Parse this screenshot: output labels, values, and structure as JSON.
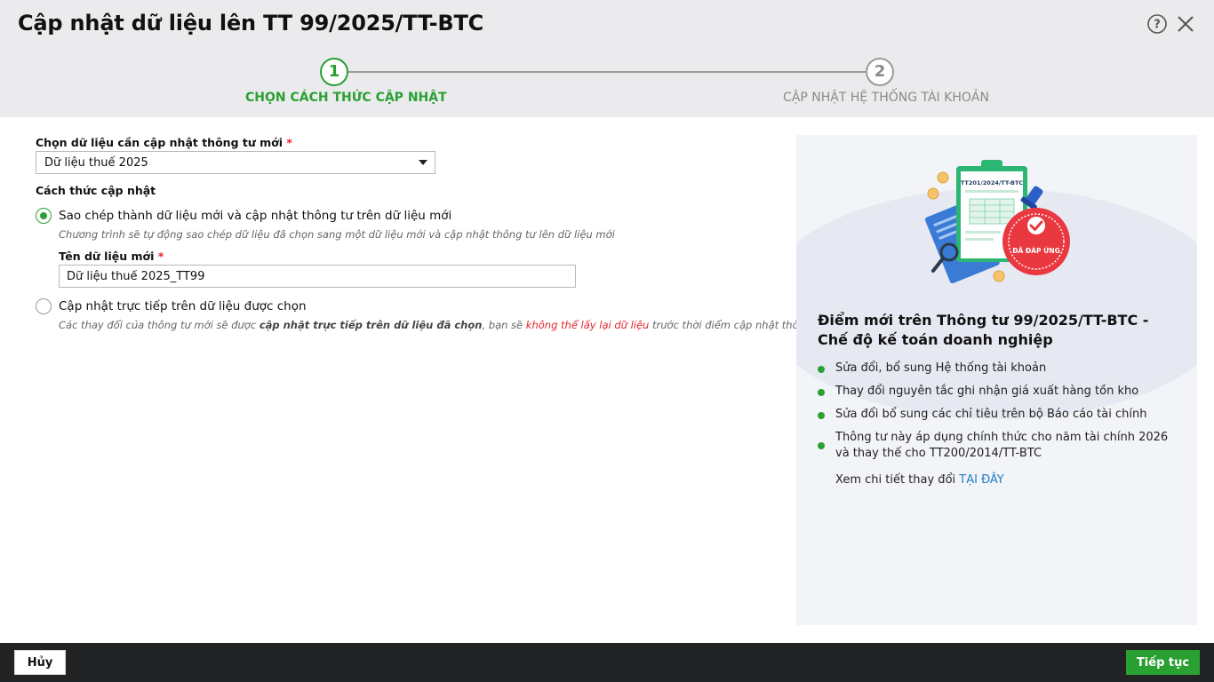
{
  "dialog": {
    "title": "Cập nhật dữ liệu lên TT 99/2025/TT-BTC"
  },
  "steps": [
    {
      "number": "1",
      "label": "CHỌN CÁCH THỨC CẬP NHẬT",
      "state": "active"
    },
    {
      "number": "2",
      "label": "CẬP NHẬT HỆ THỐNG TÀI KHOẢN",
      "state": "inactive"
    }
  ],
  "form": {
    "select_label": "Chọn dữ liệu cần cập nhật thông tư mới",
    "required_mark": "*",
    "select_value": "Dữ liệu thuế 2025",
    "method_label": "Cách thức cập nhật",
    "option_copy": {
      "label": "Sao chép thành dữ liệu mới và cập nhật thông tư trên dữ liệu mới",
      "description": "Chương trình sẽ tự động sao chép dữ liệu đã chọn sang một dữ liệu mới và cập nhật thông tư lên dữ liệu mới",
      "checked": true
    },
    "new_name_label": "Tên dữ liệu mới",
    "new_name_value": "Dữ liệu thuế 2025_TT99",
    "option_direct": {
      "label": "Cập nhật trực tiếp trên dữ liệu được chọn",
      "desc_part1": "Các thay đổi của thông tư mới sẽ được ",
      "desc_bold": "cập nhật trực tiếp trên dữ liệu đã chọn",
      "desc_part2": ", bạn sẽ ",
      "desc_red": "không thể lấy lại dữ liệu",
      "desc_part3": " trước thời điểm cập nhật thông tư",
      "checked": false
    }
  },
  "info_panel": {
    "illustration_doc_text": "TT201/2024/TT-BTC",
    "illustration_badge_text": "ĐÃ ĐÁP ỨNG",
    "title": "Điểm mới trên Thông tư 99/2025/TT-BTC - Chế độ kế toán doanh nghiệp",
    "bullets": [
      "Sửa đổi, bổ sung Hệ thống tài khoản",
      "Thay đổi nguyên tắc ghi nhận giá xuất hàng tồn kho",
      "Sửa đổi bổ sung các chỉ tiêu trên bộ Báo cáo tài chính",
      "Thông tư này áp dụng chính thức cho năm tài chính 2026 và thay thế cho TT200/2014/TT-BTC"
    ],
    "more_text": "Xem chi tiết thay đổi ",
    "more_link": "TẠI ĐÂY"
  },
  "footer": {
    "cancel_label": "Hủy",
    "next_label": "Tiếp tục"
  },
  "colors": {
    "accent": "#2aa033",
    "warning": "#e0242b",
    "link": "#1f7fc4",
    "footer_bg": "#222325",
    "header_bg": "#ebebed"
  },
  "icons": {
    "help": "help-circle-icon",
    "close": "close-icon",
    "select_arrow": "caret-down-icon"
  }
}
